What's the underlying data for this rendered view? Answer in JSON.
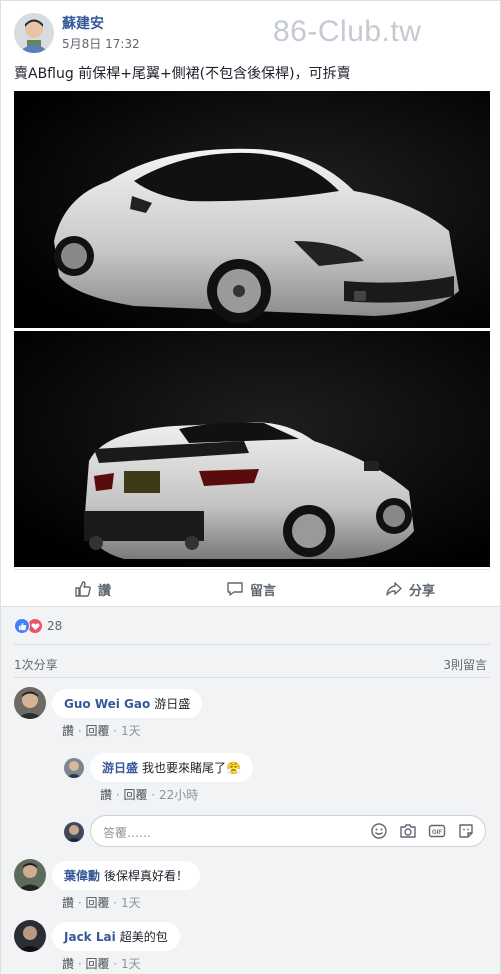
{
  "post": {
    "author": "蘇建安",
    "time": "5月8日 17:32",
    "watermark": "86-Club.tw",
    "text": "賣ABflug 前保桿+尾翼+側裙(不包含後保桿)，可拆賣",
    "photos": [
      {
        "icon": "car-front-photo"
      },
      {
        "icon": "car-rear-photo"
      }
    ]
  },
  "actions": {
    "like": "讚",
    "comment": "留言",
    "share": "分享"
  },
  "feedback": {
    "reaction_count": "28",
    "share_count": "1次分享",
    "comment_count": "3則留言"
  },
  "comments": [
    {
      "author": "Guo Wei Gao",
      "text": "游日盛",
      "like": "讚",
      "reply": "回覆",
      "time": "1天"
    },
    {
      "author": "游日盛",
      "text": "我也要來賭尾了",
      "emoji": "😤",
      "like": "讚",
      "reply": "回覆",
      "time": "22小時"
    },
    {
      "author": "葉偉勳",
      "text": "後保桿真好看！",
      "like": "讚",
      "reply": "回覆",
      "time": "1天"
    },
    {
      "author": "Jack Lai",
      "text": "超美的包",
      "like": "讚",
      "reply": "回覆",
      "time": "1天"
    }
  ],
  "reply_box": {
    "placeholder": "答覆……"
  },
  "colors": {
    "link": "#365899",
    "like_blue": "#4080ff",
    "love_red": "#f25268",
    "feedback_bg": "#f2f3f5"
  }
}
